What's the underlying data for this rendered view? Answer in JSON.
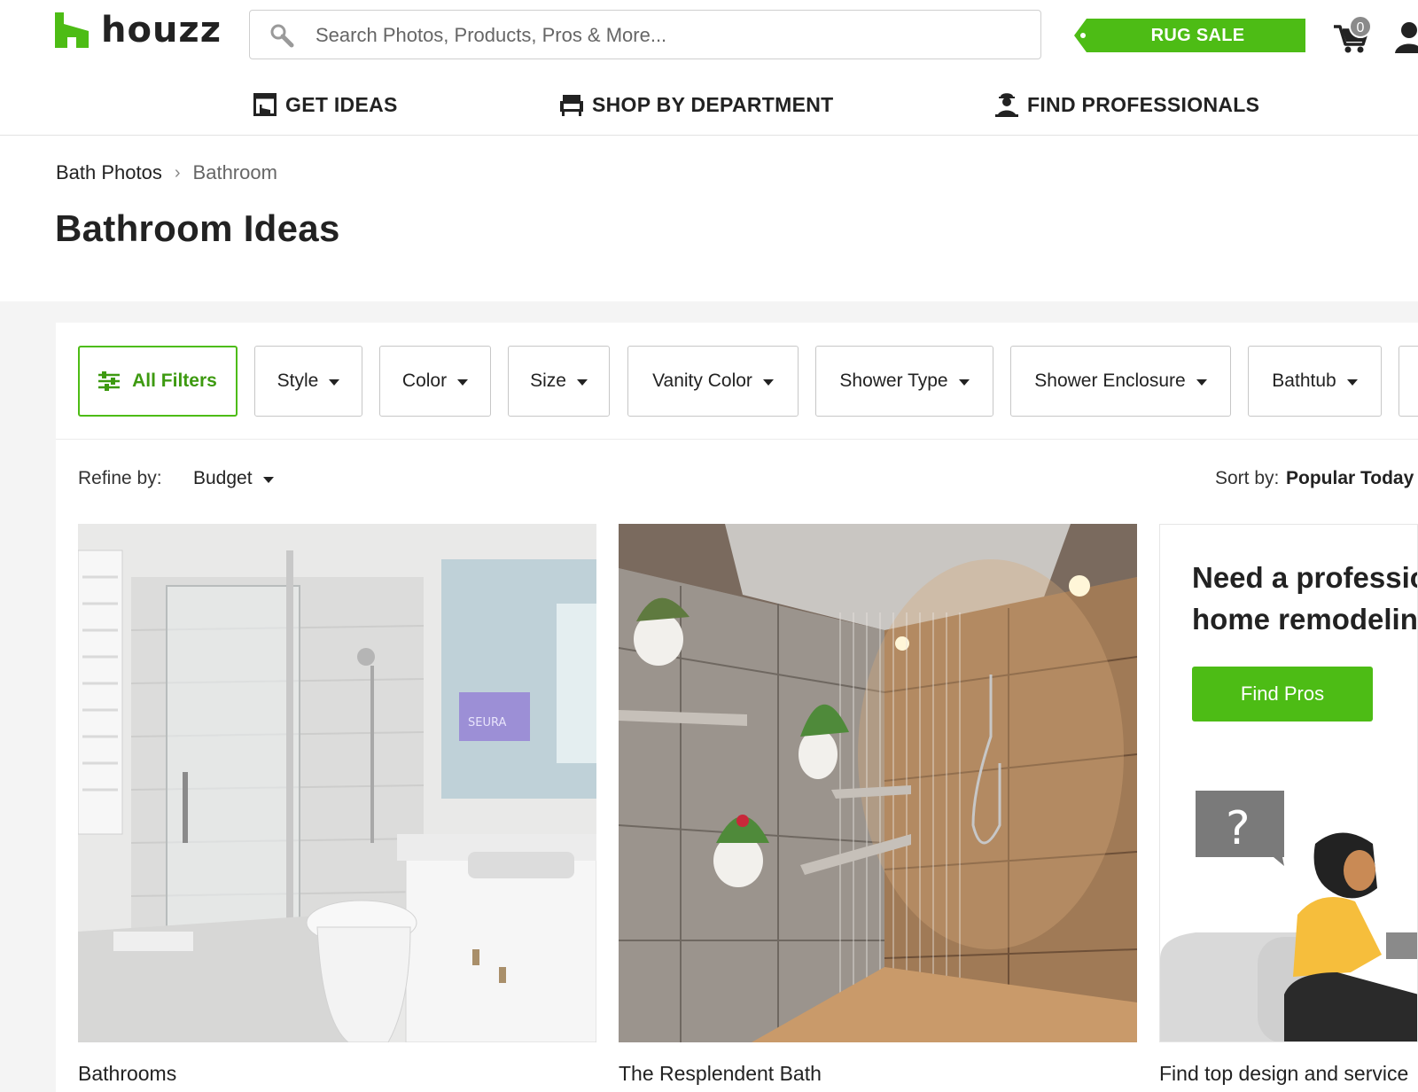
{
  "header": {
    "logo_text": "houzz",
    "search": {
      "placeholder": "Search Photos, Products, Pros & More..."
    },
    "promo_tag": "RUG SALE",
    "cart_count": "0",
    "colors": {
      "brand_green": "#4dbc15"
    }
  },
  "nav": {
    "items": [
      {
        "label": "GET IDEAS",
        "icon": "photo-frame-icon"
      },
      {
        "label": "SHOP BY DEPARTMENT",
        "icon": "armchair-icon"
      },
      {
        "label": "FIND PROFESSIONALS",
        "icon": "professional-person-icon"
      }
    ]
  },
  "breadcrumb": {
    "items": [
      "Bath Photos",
      "Bathroom"
    ],
    "separator": "›"
  },
  "page_title": "Bathroom Ideas",
  "filters": {
    "all_filters": "All Filters",
    "dropdowns": [
      "Style",
      "Color",
      "Size",
      "Vanity Color",
      "Shower Type",
      "Shower Enclosure",
      "Bathtub"
    ]
  },
  "refine": {
    "label": "Refine by:",
    "budget": "Budget"
  },
  "sort": {
    "label": "Sort by:",
    "value": "Popular Today"
  },
  "cards": [
    {
      "caption": "Bathrooms",
      "photo_overlay": "SEURA"
    },
    {
      "caption": "The Resplendent Bath"
    }
  ],
  "promo": {
    "line1": "Need a professional",
    "line2": "home remodeling",
    "button": "Find Pros",
    "caption": "Find top design and service"
  }
}
